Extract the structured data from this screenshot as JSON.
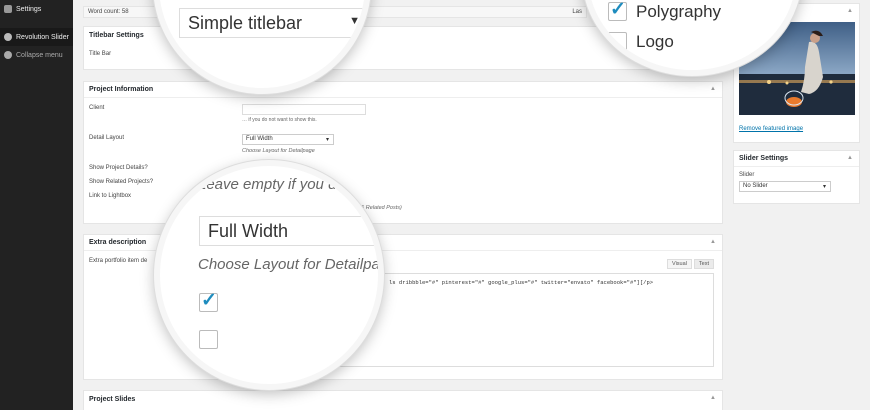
{
  "sidebar": {
    "items": [
      {
        "label": "Settings",
        "icon": "settings-icon"
      },
      {
        "label": "Revolution Slider",
        "icon": "revolution-slider-icon"
      },
      {
        "label": "Collapse menu",
        "icon": "collapse-menu-icon"
      }
    ]
  },
  "editor_status": {
    "word_count": "Word count: 58",
    "last": "Las"
  },
  "titlebar_settings": {
    "title": "Titlebar Settings",
    "title_bar_label": "Title Bar"
  },
  "project_info": {
    "title": "Project Information",
    "client_label": "Client",
    "client_hint": "… if you do not want to show this.",
    "detail_layout_label": "Detail Layout",
    "detail_layout_value": "Full Width",
    "detail_layout_hint": "Choose Layout for Detailpage",
    "show_details_label": "Show Project Details?",
    "show_related_label": "Show Related Projects?",
    "lightbox_label": "Link to Lightbox",
    "related_hint": "e & Related Posts)"
  },
  "extra_description": {
    "title": "Extra description",
    "field_label": "Extra portfolio item de",
    "tab_visual": "Visual",
    "tab_text": "Text",
    "content": "ls dribbble=\"#\" pinterest=\"#\" google_plus=\"#\" twitter=\"envato\" facebook=\"#\"][/p>"
  },
  "project_slides": {
    "title": "Project Slides"
  },
  "featured": {
    "remove_link": "Remove featured image"
  },
  "slider_settings": {
    "title": "Slider Settings",
    "slider_label": "Slider",
    "slider_value": "No Slider"
  },
  "lens_top": {
    "select_value": "Simple titlebar"
  },
  "lens_right": {
    "item_polygraphy": "Polygraphy",
    "item_logo": "Logo"
  },
  "lens_bottom": {
    "hint_top": "Leave empty if you d",
    "select_value": "Full Width",
    "hint_layout": "Choose Layout for Detailpa"
  }
}
